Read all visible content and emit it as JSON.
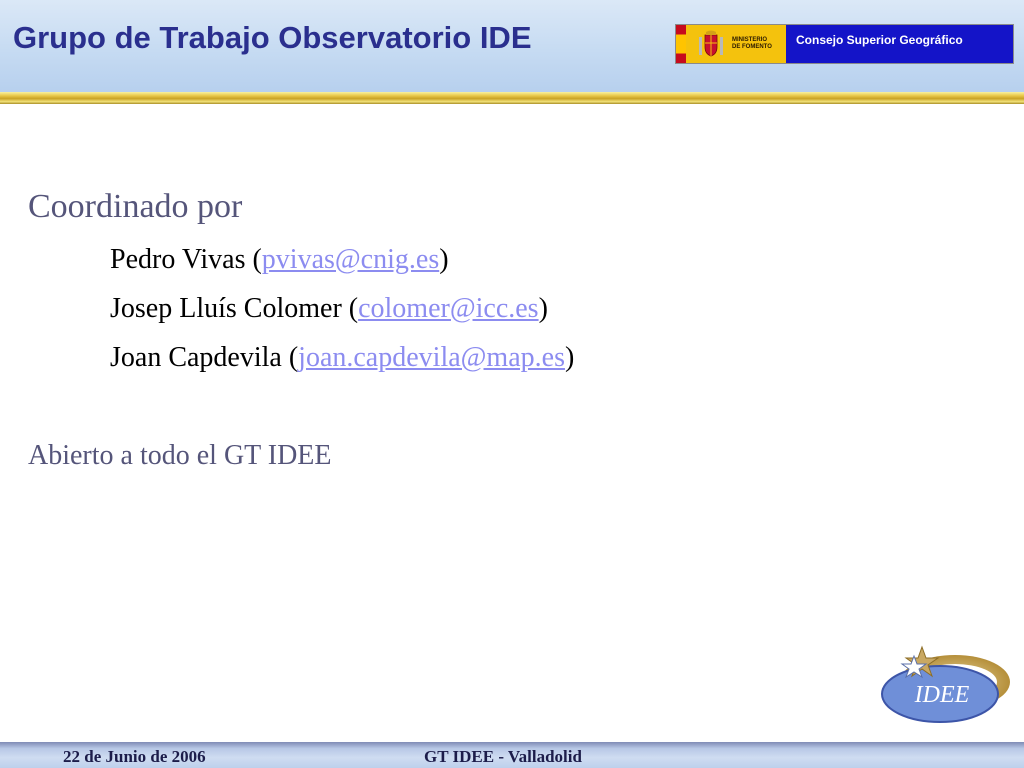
{
  "header": {
    "title": "Grupo de Trabajo Observatorio IDE",
    "logo": {
      "ministry_text_line1": "MINISTERIO",
      "ministry_text_line2": "DE FOMENTO",
      "agency": "Consejo Superior Geográfico"
    }
  },
  "content": {
    "heading": "Coordinado por",
    "people": [
      {
        "name": "Pedro Vivas (",
        "email": "pvivas@cnig.es",
        "close": ")"
      },
      {
        "name": "Josep Lluís Colomer (",
        "email": "colomer@icc.es",
        "close": ")"
      },
      {
        "name": "Joan Capdevila (",
        "email": "joan.capdevila@map.es",
        "close": ")"
      }
    ],
    "open_to": "Abierto a todo el GT IDEE"
  },
  "logo_idee": {
    "text": "IDEE"
  },
  "footer": {
    "date": "22 de Junio de 2006",
    "event": "GT IDEE - Valladolid"
  },
  "colors": {
    "title": "#2a2f8e",
    "agency_bg": "#1414c8",
    "link": "#8c8cf0",
    "heading": "#55557a"
  }
}
